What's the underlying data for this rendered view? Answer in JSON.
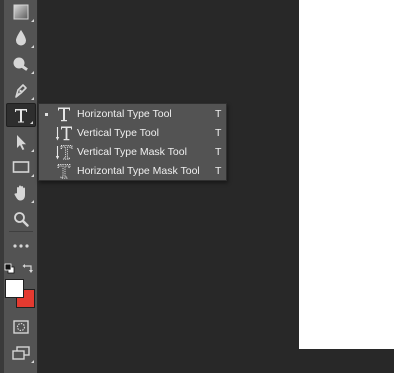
{
  "toolbar": {
    "tools": [
      {
        "name": "gradient-tool",
        "icon": "gradient-icon"
      },
      {
        "name": "blur-tool",
        "icon": "drop-icon"
      },
      {
        "name": "dodge-tool",
        "icon": "dodge-icon"
      },
      {
        "name": "pen-tool",
        "icon": "pen-icon"
      },
      {
        "name": "type-tool",
        "icon": "type-icon",
        "active": true
      },
      {
        "name": "path-selection-tool",
        "icon": "arrow-icon"
      },
      {
        "name": "rectangle-tool",
        "icon": "rectangle-icon"
      },
      {
        "name": "hand-tool",
        "icon": "hand-icon"
      },
      {
        "name": "zoom-tool",
        "icon": "magnifier-icon"
      },
      {
        "name": "edit-toolbar",
        "icon": "ellipsis-icon"
      },
      {
        "name": "quick-mask",
        "icon": "quick-mask-icon"
      },
      {
        "name": "screen-mode",
        "icon": "screen-mode-icon"
      }
    ],
    "foreground_color": "#ffffff",
    "background_color": "#e43a30"
  },
  "flyout": {
    "items": [
      {
        "label": "Horizontal Type Tool",
        "shortcut": "T",
        "selected": true,
        "icon": "horizontal-type-icon"
      },
      {
        "label": "Vertical Type Tool",
        "shortcut": "T",
        "selected": false,
        "icon": "vertical-type-icon"
      },
      {
        "label": "Vertical Type Mask Tool",
        "shortcut": "T",
        "selected": false,
        "icon": "vertical-type-mask-icon"
      },
      {
        "label": "Horizontal Type Mask Tool",
        "shortcut": "T",
        "selected": false,
        "icon": "horizontal-type-mask-icon"
      }
    ]
  },
  "colors": {
    "panel": "#535353",
    "workspace": "#282828",
    "canvas": "#ffffff",
    "text": "#efefef"
  }
}
